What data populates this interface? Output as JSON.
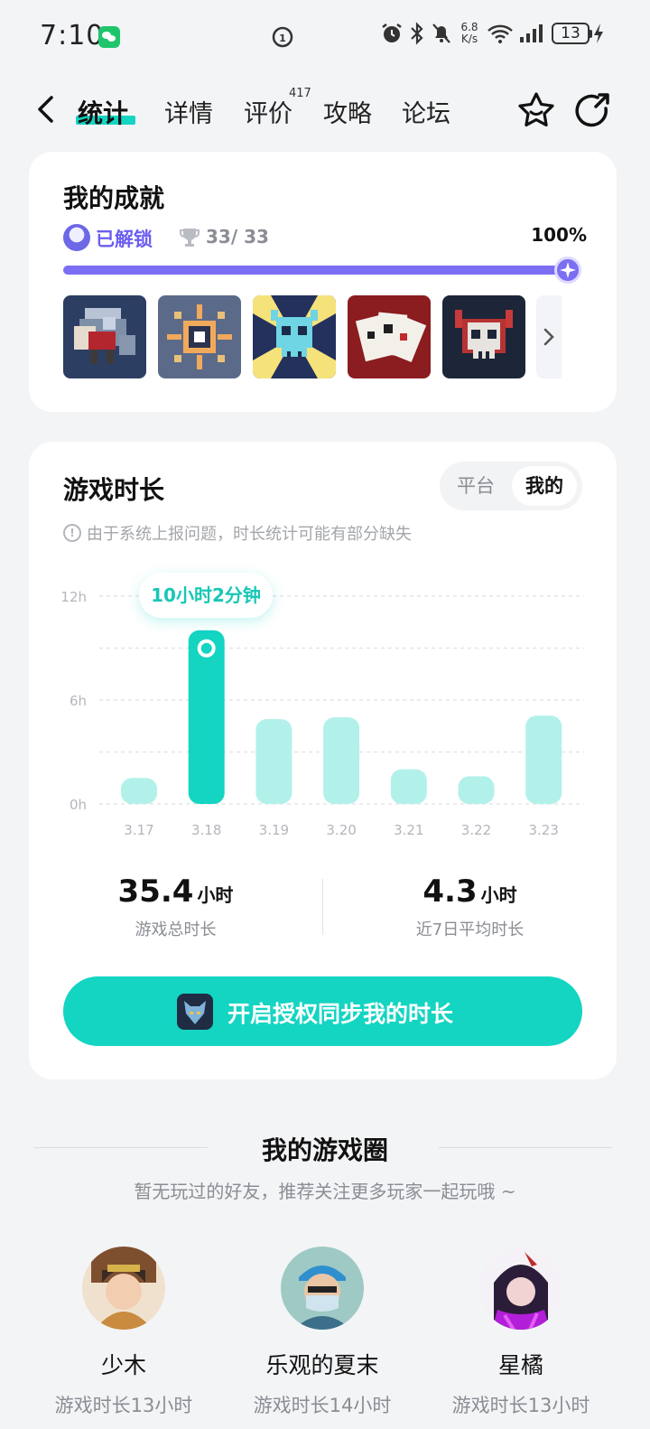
{
  "status_bar": {
    "time": "7:10",
    "net_speed_value": "6.8",
    "net_speed_unit": "K/s",
    "battery": "13"
  },
  "nav": {
    "tabs": [
      {
        "label": "统计",
        "active": true
      },
      {
        "label": "详情"
      },
      {
        "label": "评价"
      },
      {
        "label": "攻略"
      },
      {
        "label": "论坛"
      }
    ],
    "review_count": "417"
  },
  "achievements": {
    "title": "我的成就",
    "unlocked_label": "已解锁",
    "count": "33/ 33",
    "percent_text": "100%",
    "progress": 1.0,
    "badge_icons": [
      "warrior-badge-icon",
      "compass-badge-icon",
      "skull-burst-badge-icon",
      "cards-badge-icon",
      "demon-skull-badge-icon"
    ]
  },
  "playtime": {
    "title": "游戏时长",
    "toggle": {
      "platform": "平台",
      "mine": "我的"
    },
    "notice": "由于系统上报问题，时长统计可能有部分缺失",
    "tooltip": "10小时2分钟",
    "total": {
      "value": "35.4",
      "unit": "小时",
      "label": "游戏总时长"
    },
    "average": {
      "value": "4.3",
      "unit": "小时",
      "label": "近7日平均时长"
    },
    "sync_button": "开启授权同步我的时长"
  },
  "chart_data": {
    "type": "bar",
    "categories": [
      "3.17",
      "3.18",
      "3.19",
      "3.20",
      "3.21",
      "3.22",
      "3.23"
    ],
    "values": [
      1.5,
      10.03,
      4.9,
      5.0,
      2.0,
      1.6,
      5.1
    ],
    "y_ticks": [
      "12h",
      "6h",
      "0h"
    ],
    "ylim": [
      0,
      12
    ],
    "highlight_index": 1,
    "colors": {
      "bar": "#b2f1ea",
      "highlight": "#14d4c2"
    }
  },
  "game_circle": {
    "title": "我的游戏圈",
    "subtitle": "暂无玩过的好友，推荐关注更多玩家一起玩哦 ~",
    "friends": [
      {
        "name": "少木",
        "playtime": "游戏时长13小时"
      },
      {
        "name": "乐观的夏末",
        "playtime": "游戏时长14小时"
      },
      {
        "name": "星橘",
        "playtime": "游戏时长13小时"
      }
    ]
  }
}
